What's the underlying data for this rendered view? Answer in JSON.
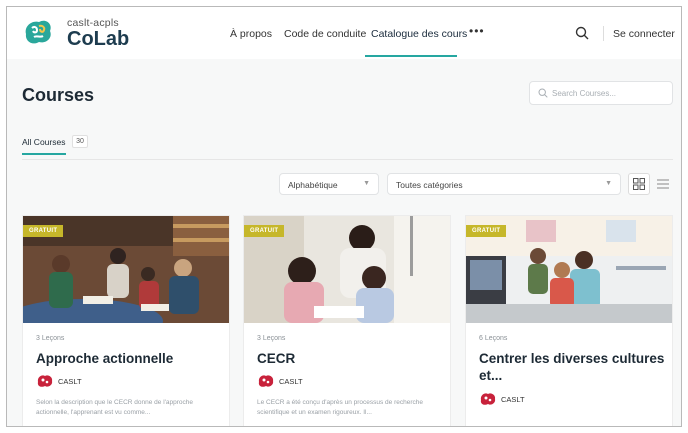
{
  "brand": {
    "top": "caslt-acpls",
    "name": "CoLab"
  },
  "nav": {
    "items": [
      {
        "label": "À propos"
      },
      {
        "label": "Code de conduite"
      },
      {
        "label": "Catalogue des cours",
        "active": true
      }
    ],
    "more": "•••",
    "sign_in": "Se connecter"
  },
  "page": {
    "title": "Courses",
    "search_placeholder": "Search Courses...",
    "tab": {
      "label": "All Courses",
      "count": "30"
    },
    "sort": "Alphabétique",
    "category": "Toutes catégories"
  },
  "courses": [
    {
      "badge": "GRATUIT",
      "lessons": "3 Leçons",
      "title": "Approche actionnelle",
      "author": "CASLT",
      "description": "Selon la description que le CECR donne de l'approche actionnelle, l'apprenant est vu comme..."
    },
    {
      "badge": "GRATUIT",
      "lessons": "3 Leçons",
      "title": "CECR",
      "author": "CASLT",
      "description": "Le CECR a été conçu d'après un processus de recherche scientifique et un examen rigoureux. Il..."
    },
    {
      "badge": "GRATUIT",
      "lessons": "6 Leçons",
      "title": "Centrer les diverses cultures et...",
      "author": "CASLT",
      "description": ""
    }
  ],
  "colors": {
    "accent": "#26a7a1",
    "badge": "#c6b72a",
    "brand_red": "#c8223b"
  },
  "icons": [
    "logo-icon",
    "search-icon",
    "chevron-down-icon",
    "grid-view-icon",
    "list-view-icon",
    "author-icon"
  ]
}
